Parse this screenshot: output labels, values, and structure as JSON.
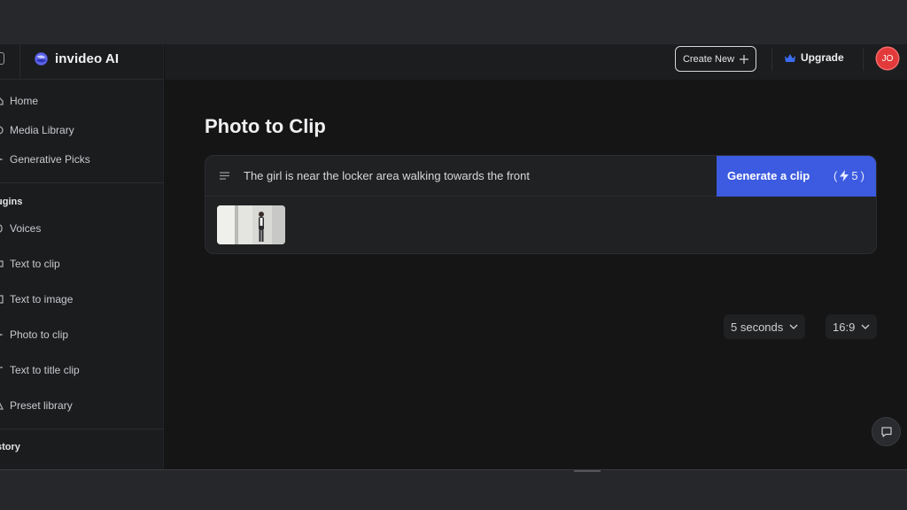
{
  "brand": {
    "name": "invideo AI"
  },
  "sidebar": {
    "nav": [
      {
        "label": "Home",
        "icon": "home-icon"
      },
      {
        "label": "Media Library",
        "icon": "media-icon"
      },
      {
        "label": "Generative Picks",
        "icon": "sparkle-icon"
      }
    ],
    "plugins_title": "ugins",
    "plugins": [
      {
        "label": "Voices",
        "icon": "voice-icon"
      },
      {
        "label": "Text to clip",
        "icon": "clip-icon"
      },
      {
        "label": "Text to image",
        "icon": "image-icon"
      },
      {
        "label": "Photo to clip",
        "icon": "photo-icon"
      },
      {
        "label": "Text to title clip",
        "icon": "title-icon"
      },
      {
        "label": "Preset library",
        "icon": "preset-icon"
      }
    ],
    "history_title": "story"
  },
  "header": {
    "create_label": "Create New",
    "upgrade_label": "Upgrade",
    "avatar_initials": "JO"
  },
  "main": {
    "title": "Photo to Clip",
    "prompt_text": "The girl is near the locker area walking towards the front",
    "generate_label": "Generate a clip",
    "credits_open": "(",
    "credits_value": "5",
    "credits_close": ")",
    "duration_label": "5 seconds",
    "aspect_label": "16:9"
  },
  "colors": {
    "accent": "#3c5be0",
    "avatar": "#e23a3a",
    "upgrade_crown": "#3b6cf0"
  }
}
